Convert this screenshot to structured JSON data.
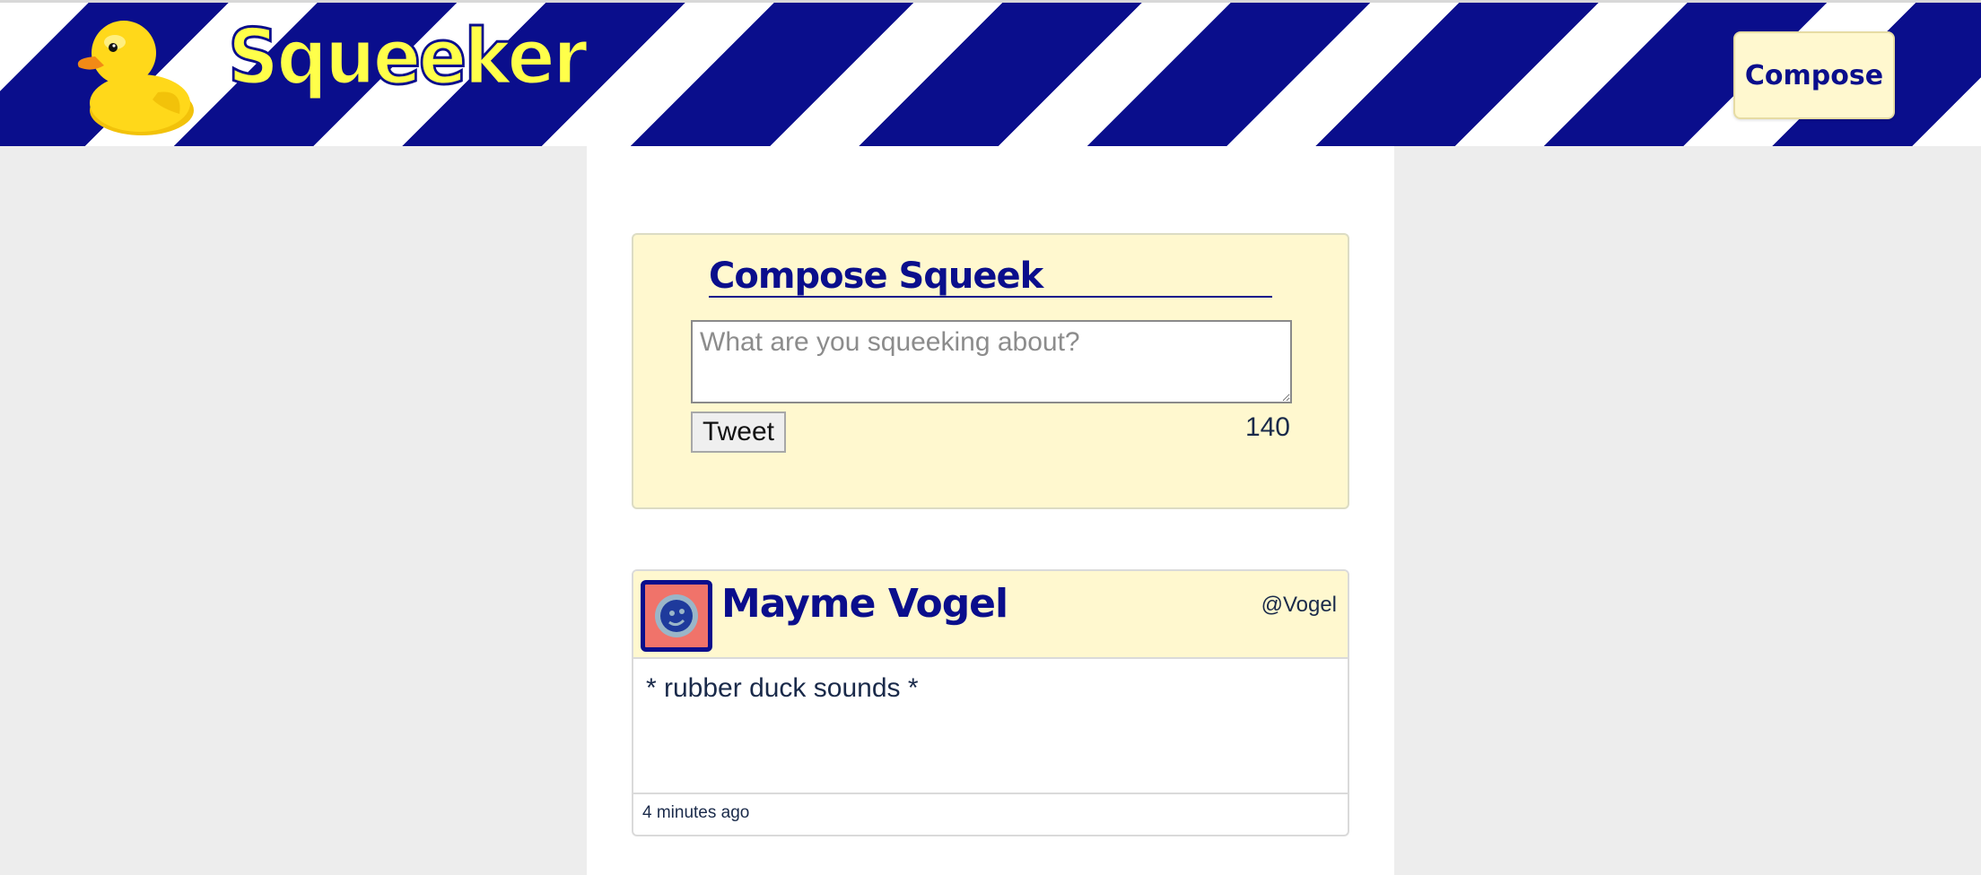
{
  "app": {
    "brand": "Squeeker",
    "logo_icon": "rubber-duck-icon"
  },
  "nav": {
    "compose_label": "Compose"
  },
  "compose": {
    "title": "Compose Squeek",
    "placeholder": "What are you squeeking about?",
    "value": "",
    "submit_label": "Tweet",
    "char_counter": "140"
  },
  "feed": {
    "tweets": [
      {
        "author_name": "Mayme Vogel",
        "handle": "@Vogel",
        "avatar_icon": "robot-avatar-icon",
        "text": "* rubber duck sounds *",
        "time": "4 minutes ago"
      }
    ]
  },
  "colors": {
    "primary": "#0a0e8c",
    "accent": "#ffff4a",
    "card_bg": "#fff8cf",
    "page_bg": "#ededed",
    "avatar_bg": "#f0736a"
  }
}
